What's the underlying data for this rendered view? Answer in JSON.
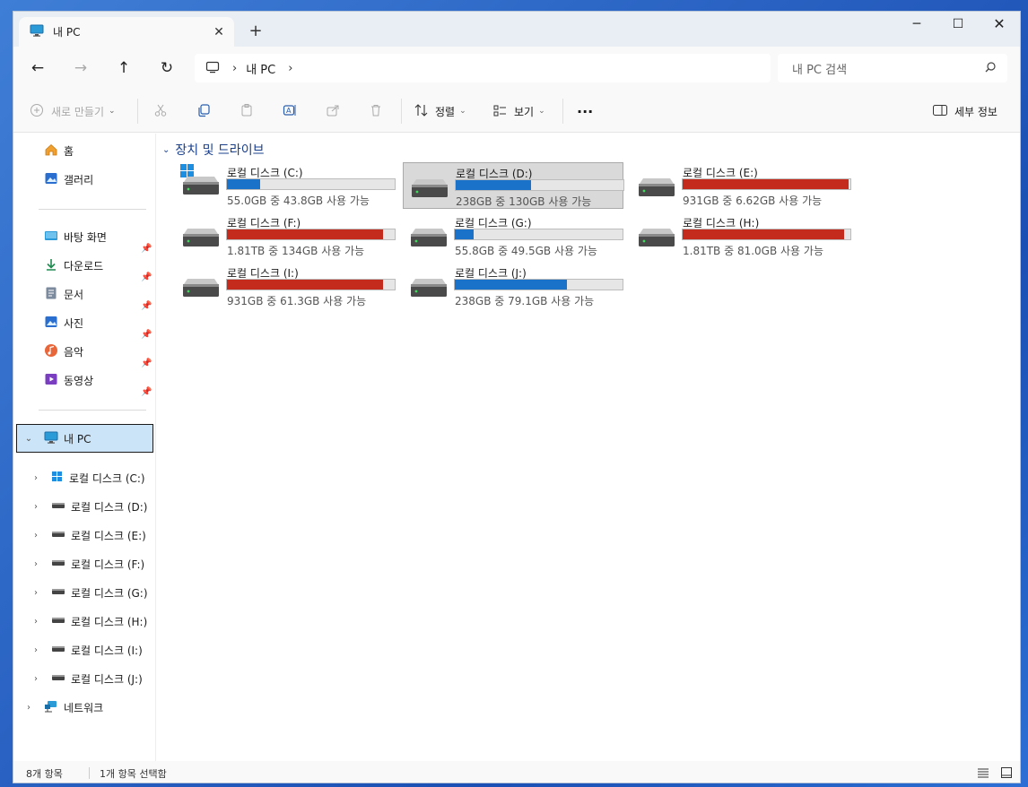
{
  "tab": {
    "title": "내 PC",
    "close": "✕",
    "new_tab": "+"
  },
  "window_controls": {
    "minimize": "─",
    "maximize": "☐",
    "close": "✕"
  },
  "nav": {
    "back": "←",
    "forward": "→",
    "up": "↑",
    "refresh": "↻"
  },
  "address": {
    "separator": "›",
    "crumb": "내 PC",
    "trailing_separator": "›"
  },
  "search": {
    "placeholder": "내 PC 검색"
  },
  "toolbar": {
    "new_label": "새로 만들기",
    "sort_label": "정렬",
    "view_label": "보기",
    "more_label": "···",
    "details_label": "세부 정보"
  },
  "sidebar": {
    "top_items": [
      {
        "label": "홈"
      },
      {
        "label": "갤러리"
      }
    ],
    "pinned_items": [
      {
        "label": "바탕 화면"
      },
      {
        "label": "다운로드"
      },
      {
        "label": "문서"
      },
      {
        "label": "사진"
      },
      {
        "label": "음악"
      },
      {
        "label": "동영상"
      }
    ],
    "this_pc": "내 PC",
    "drives": [
      {
        "label": "로컬 디스크 (C:)"
      },
      {
        "label": "로컬 디스크 (D:)"
      },
      {
        "label": "로컬 디스크 (E:)"
      },
      {
        "label": "로컬 디스크 (F:)"
      },
      {
        "label": "로컬 디스크 (G:)"
      },
      {
        "label": "로컬 디스크 (H:)"
      },
      {
        "label": "로컬 디스크 (I:)"
      },
      {
        "label": "로컬 디스크 (J:)"
      }
    ],
    "network": "네트워크"
  },
  "content": {
    "group_title": "장치 및 드라이브",
    "drives": [
      {
        "name": "로컬 디스크 (C:)",
        "free_text": "55.0GB 중 43.8GB 사용 가능",
        "used_fraction": 0.2,
        "bar_color": "#1a73c9",
        "selected": false
      },
      {
        "name": "로컬 디스크 (D:)",
        "free_text": "238GB 중 130GB 사용 가능",
        "used_fraction": 0.45,
        "bar_color": "#1a73c9",
        "selected": true
      },
      {
        "name": "로컬 디스크 (E:)",
        "free_text": "931GB 중 6.62GB 사용 가능",
        "used_fraction": 0.99,
        "bar_color": "#c42b1c",
        "selected": false
      },
      {
        "name": "로컬 디스크 (F:)",
        "free_text": "1.81TB 중 134GB 사용 가능",
        "used_fraction": 0.93,
        "bar_color": "#c42b1c",
        "selected": false
      },
      {
        "name": "로컬 디스크 (G:)",
        "free_text": "55.8GB 중 49.5GB 사용 가능",
        "used_fraction": 0.11,
        "bar_color": "#1a73c9",
        "selected": false
      },
      {
        "name": "로컬 디스크 (H:)",
        "free_text": "1.81TB 중 81.0GB 사용 가능",
        "used_fraction": 0.96,
        "bar_color": "#c42b1c",
        "selected": false
      },
      {
        "name": "로컬 디스크 (I:)",
        "free_text": "931GB 중 61.3GB 사용 가능",
        "used_fraction": 0.93,
        "bar_color": "#c42b1c",
        "selected": false
      },
      {
        "name": "로컬 디스크 (J:)",
        "free_text": "238GB 중 79.1GB 사용 가능",
        "used_fraction": 0.67,
        "bar_color": "#1a73c9",
        "selected": false
      }
    ]
  },
  "status": {
    "item_count": "8개 항목",
    "selected_count": "1개 항목 선택함"
  },
  "icons": {
    "pc": "pc-icon",
    "home": "home-icon",
    "gallery": "gallery-icon",
    "desktop": "desktop-icon",
    "download": "download-icon",
    "documents": "documents-icon",
    "pictures": "pictures-icon",
    "music": "music-icon",
    "videos": "videos-icon",
    "drive": "drive-icon",
    "network": "network-icon"
  }
}
